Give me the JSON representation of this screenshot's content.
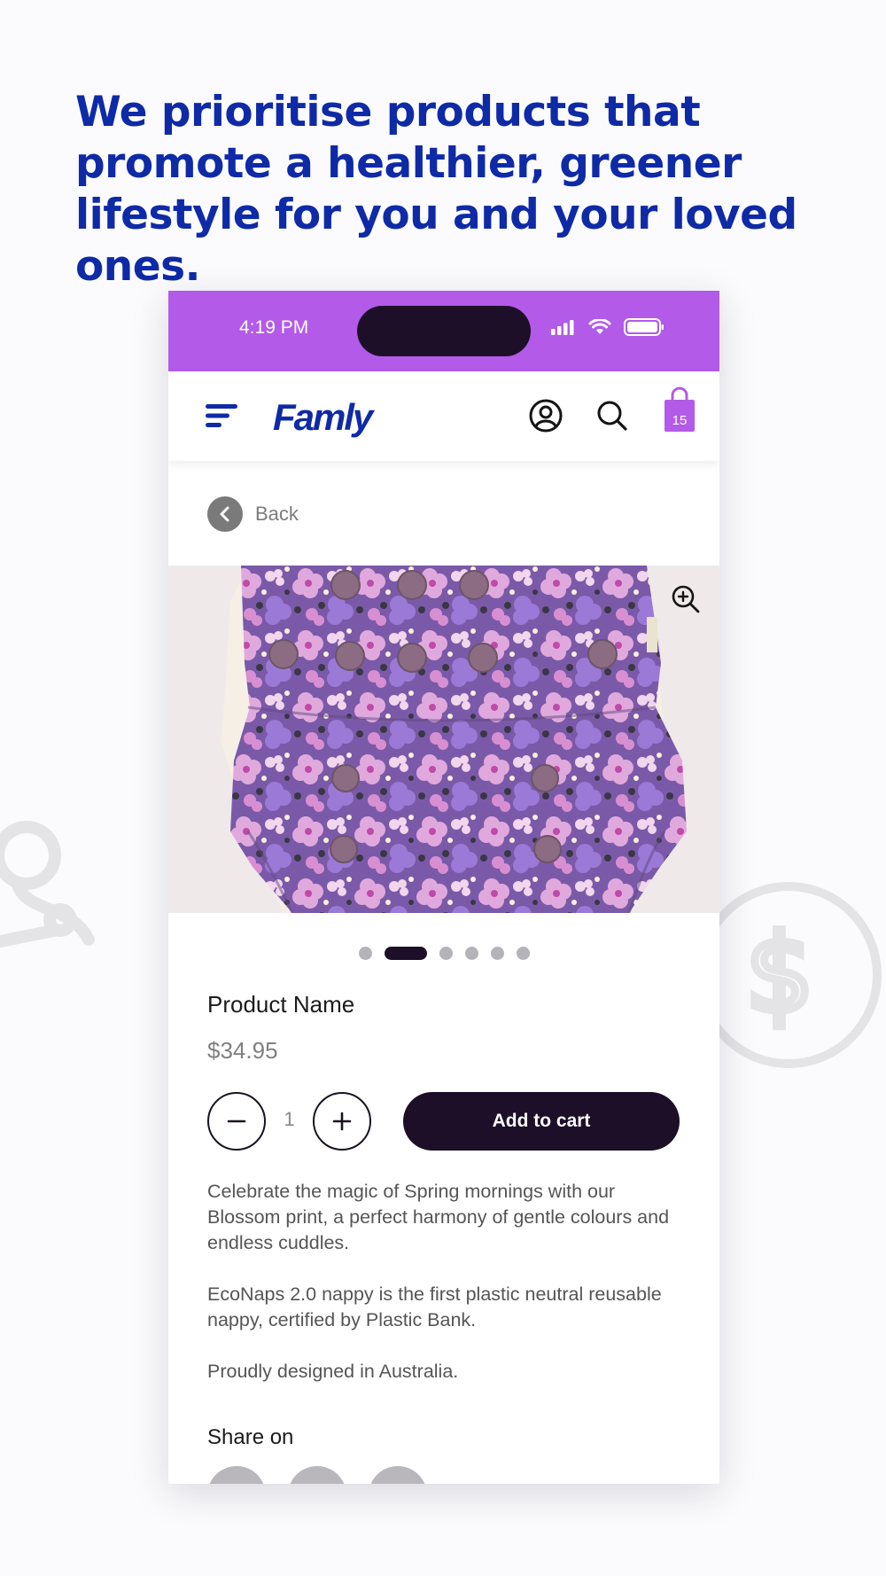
{
  "headline": "We prioritise products that promote a healthier, greener lifestyle for you and your loved ones.",
  "status_bar": {
    "time": "4:19 PM"
  },
  "header": {
    "brand": "Famly",
    "cart_count": "15"
  },
  "back": {
    "label": "Back"
  },
  "gallery": {
    "image_count": 6,
    "active_index": 2
  },
  "product": {
    "name": "Product Name",
    "price": "$34.95",
    "quantity": "1",
    "add_to_cart_label": "Add to cart",
    "description": [
      "Celebrate the magic of Spring mornings with our Blossom print, a perfect harmony of gentle colours and endless cuddles.",
      "EcoNaps 2.0 nappy is the first plastic neutral reusable nappy, certified by Plastic Bank.",
      "Proudly designed in Australia."
    ]
  },
  "share": {
    "title": "Share on",
    "networks": [
      "facebook-icon",
      "x-icon",
      "pinterest-icon"
    ]
  },
  "colors": {
    "headline": "#0f2aa6",
    "status_bar": "#b35ae8",
    "primary_dark": "#1c0f27",
    "cart_bag": "#b35ae8"
  }
}
